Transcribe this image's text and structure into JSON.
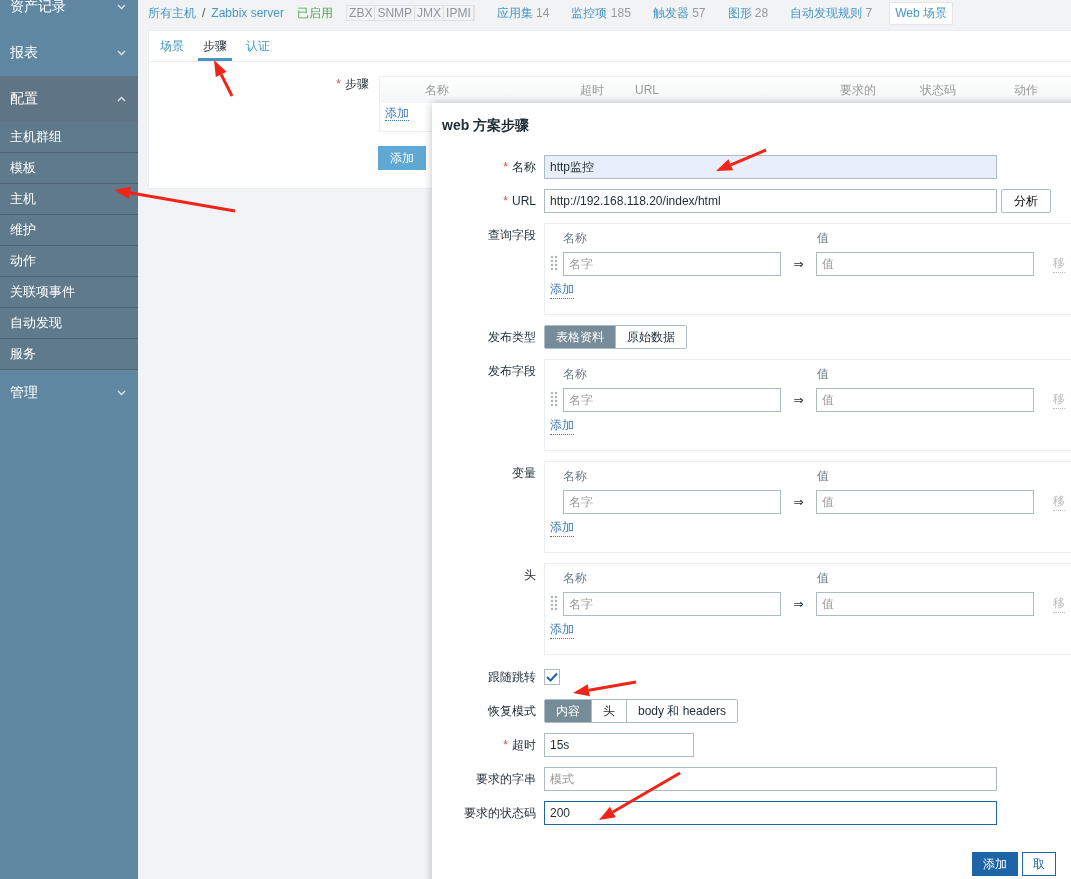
{
  "sidebar": [
    {
      "label": "资产记录",
      "expanded": false
    },
    {
      "label": "报表",
      "expanded": false
    },
    {
      "label": "配置",
      "expanded": true,
      "items": [
        "主机群组",
        "模板",
        "主机",
        "维护",
        "动作",
        "关联项事件",
        "自动发现",
        "服务"
      ]
    },
    {
      "label": "管理",
      "expanded": false
    }
  ],
  "header": {
    "breadcrumbs": [
      "所有主机",
      "Zabbix server"
    ],
    "separator": "/",
    "status": "已启用",
    "badges": [
      "ZBX",
      "SNMP",
      "JMX",
      "IPMI"
    ],
    "tabs": [
      {
        "label": "应用集",
        "count": "14",
        "selected": false
      },
      {
        "label": "监控项",
        "count": "185",
        "selected": false
      },
      {
        "label": "触发器",
        "count": "57",
        "selected": false
      },
      {
        "label": "图形",
        "count": "28",
        "selected": false
      },
      {
        "label": "自动发现规则",
        "count": "7",
        "selected": false
      },
      {
        "label": "Web 场景",
        "selected": true
      }
    ]
  },
  "required_mark": "*",
  "panel": {
    "tabs": [
      {
        "label": "场景",
        "selected": false
      },
      {
        "label": "步骤",
        "selected": true
      },
      {
        "label": "认证",
        "selected": false
      }
    ],
    "steps_label": "步骤",
    "steps_required": true,
    "columns": [
      "名称",
      "超时",
      "URL",
      "要求的",
      "状态码",
      "动作"
    ],
    "add_link": "添加",
    "add_button": "添加"
  },
  "dialog": {
    "title": "web 方案步骤",
    "rows": [
      {
        "kind": "input",
        "label": "名称",
        "required": true,
        "value": "http监控",
        "highlighted": true
      },
      {
        "kind": "input",
        "label": "URL",
        "required": true,
        "value": "http://192.168.118.20/index/html",
        "button": "分析"
      },
      {
        "kind": "pairs",
        "label": "查询字段",
        "name_header": "名称",
        "value_header": "值",
        "name_placeholder": "名字",
        "value_placeholder": "值",
        "arrow": "⇒",
        "remove": "移",
        "add": "添加",
        "drag": true
      },
      {
        "kind": "segmented",
        "label": "发布类型",
        "options": [
          {
            "label": "表格资料",
            "selected": true
          },
          {
            "label": "原始数据",
            "selected": false
          }
        ]
      },
      {
        "kind": "pairs",
        "label": "发布字段",
        "name_header": "名称",
        "value_header": "值",
        "name_placeholder": "名字",
        "value_placeholder": "值",
        "arrow": "⇒",
        "remove": "移",
        "add": "添加",
        "drag": true
      },
      {
        "kind": "pairs",
        "label": "变量",
        "name_header": "名称",
        "value_header": "值",
        "name_placeholder": "名字",
        "value_placeholder": "值",
        "arrow": "⇒",
        "remove": "移",
        "add": "添加",
        "drag": false
      },
      {
        "kind": "pairs",
        "label": "头",
        "name_header": "名称",
        "value_header": "值",
        "name_placeholder": "名字",
        "value_placeholder": "值",
        "arrow": "⇒",
        "remove": "移",
        "add": "添加",
        "drag": true
      },
      {
        "kind": "checkbox",
        "label": "跟随跳转",
        "checked": true
      },
      {
        "kind": "segmented",
        "label": "恢复模式",
        "options": [
          {
            "label": "内容",
            "selected": true
          },
          {
            "label": "头",
            "selected": false
          },
          {
            "label": "body 和 headers",
            "selected": false
          }
        ]
      },
      {
        "kind": "short_input",
        "label": "超时",
        "required": true,
        "value": "15s"
      },
      {
        "kind": "input",
        "label": "要求的字串",
        "required": false,
        "placeholder": "模式"
      },
      {
        "kind": "input",
        "label": "要求的状态码",
        "required": false,
        "value": "200",
        "focused": true
      }
    ],
    "buttons": [
      {
        "label": "添加",
        "primary": true
      },
      {
        "label": "取",
        "primary": false
      }
    ]
  }
}
